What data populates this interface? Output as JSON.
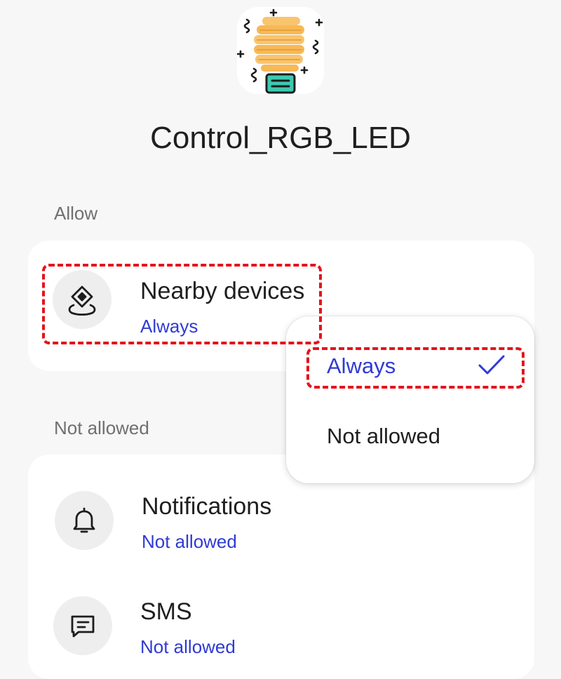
{
  "app": {
    "icon": "light-bulb-app-icon",
    "title": "Control_RGB_LED"
  },
  "sections": {
    "allow_label": "Allow",
    "not_allowed_label": "Not allowed"
  },
  "permissions": {
    "nearby": {
      "icon": "nearby-devices-icon",
      "name": "Nearby devices",
      "status": "Always"
    },
    "notifications": {
      "icon": "bell-icon",
      "name": "Notifications",
      "status": "Not allowed"
    },
    "sms": {
      "icon": "message-icon",
      "name": "SMS",
      "status": "Not allowed"
    }
  },
  "dropdown": {
    "options": [
      {
        "label": "Always",
        "selected": true,
        "icon": "checkmark-icon"
      },
      {
        "label": "Not allowed",
        "selected": false
      }
    ]
  },
  "colors": {
    "accent": "#2f3bd4",
    "highlight": "#e3131b",
    "bulb": "#f7b955",
    "bulb_base": "#3dc9b0"
  }
}
